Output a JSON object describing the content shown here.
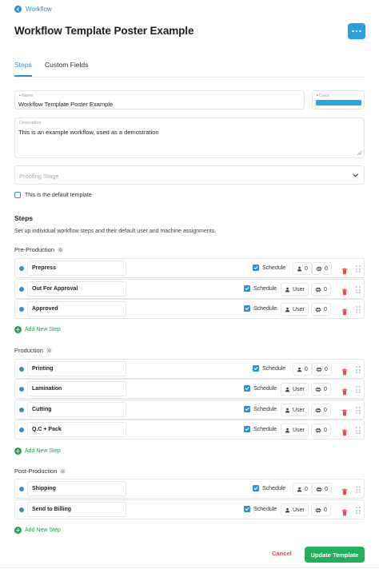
{
  "back_link": {
    "label": "Workflow"
  },
  "page_title": "Workflow Template Poster Example",
  "tabs": [
    {
      "label": "Steps",
      "active": true
    },
    {
      "label": "Custom Fields",
      "active": false
    }
  ],
  "form": {
    "name": {
      "label": "Name",
      "value": "Workflow Template Poster Example",
      "required": true
    },
    "color": {
      "label": "Color",
      "value": "#2aa3de",
      "required": true
    },
    "description": {
      "label": "Description",
      "value": "This is an example workflow, used as a demostration"
    },
    "proofing_stage": {
      "placeholder": "Proofing Stage"
    },
    "default_template": {
      "label": "This is the default template",
      "checked": false
    }
  },
  "steps_section": {
    "heading": "Steps",
    "description": "Set up individual workflow steps and their default user and machine assignments."
  },
  "groups": [
    {
      "title": "Pre-Production",
      "steps": [
        {
          "name": "Prepress",
          "schedule_label": "Schedule",
          "schedule_checked": true,
          "user": "0",
          "machine": "0"
        },
        {
          "name": "Out For Approval",
          "schedule_label": "Schedule",
          "schedule_checked": true,
          "user": "User",
          "machine": "0"
        },
        {
          "name": "Approved",
          "schedule_label": "Schedule",
          "schedule_checked": true,
          "user": "User",
          "machine": "0"
        }
      ],
      "add_label": "Add New Step"
    },
    {
      "title": "Production",
      "steps": [
        {
          "name": "Printing",
          "schedule_label": "Schedule",
          "schedule_checked": true,
          "user": "0",
          "machine": "0"
        },
        {
          "name": "Lamination",
          "schedule_label": "Schedule",
          "schedule_checked": true,
          "user": "User",
          "machine": "0"
        },
        {
          "name": "Cutting",
          "schedule_label": "Schedule",
          "schedule_checked": true,
          "user": "User",
          "machine": "0"
        },
        {
          "name": "Q.C + Pack",
          "schedule_label": "Schedule",
          "schedule_checked": true,
          "user": "User",
          "machine": "0"
        }
      ],
      "add_label": "Add New Step"
    },
    {
      "title": "Post-Production",
      "steps": [
        {
          "name": "Shipping",
          "schedule_label": "Schedule",
          "schedule_checked": true,
          "user": "0",
          "machine": "0"
        },
        {
          "name": "Send to Billing",
          "schedule_label": "Schedule",
          "schedule_checked": true,
          "user": "User",
          "machine": "0"
        }
      ],
      "add_label": "Add New Step"
    }
  ],
  "footer": {
    "cancel_label": "Cancel",
    "update_label": "Update Template"
  },
  "colors": {
    "accent": "#2f8fd4",
    "success": "#22b060",
    "danger": "#e5484d",
    "color_swatch": "#2aa3de"
  },
  "icons": [
    "back-arrow-icon",
    "more-dots-icon",
    "chevron-down-icon",
    "gear-icon",
    "user-icon",
    "machine-icon",
    "trash-icon",
    "drag-handle-icon",
    "plus-icon",
    "checkmark-icon",
    "resize-grip-icon"
  ]
}
